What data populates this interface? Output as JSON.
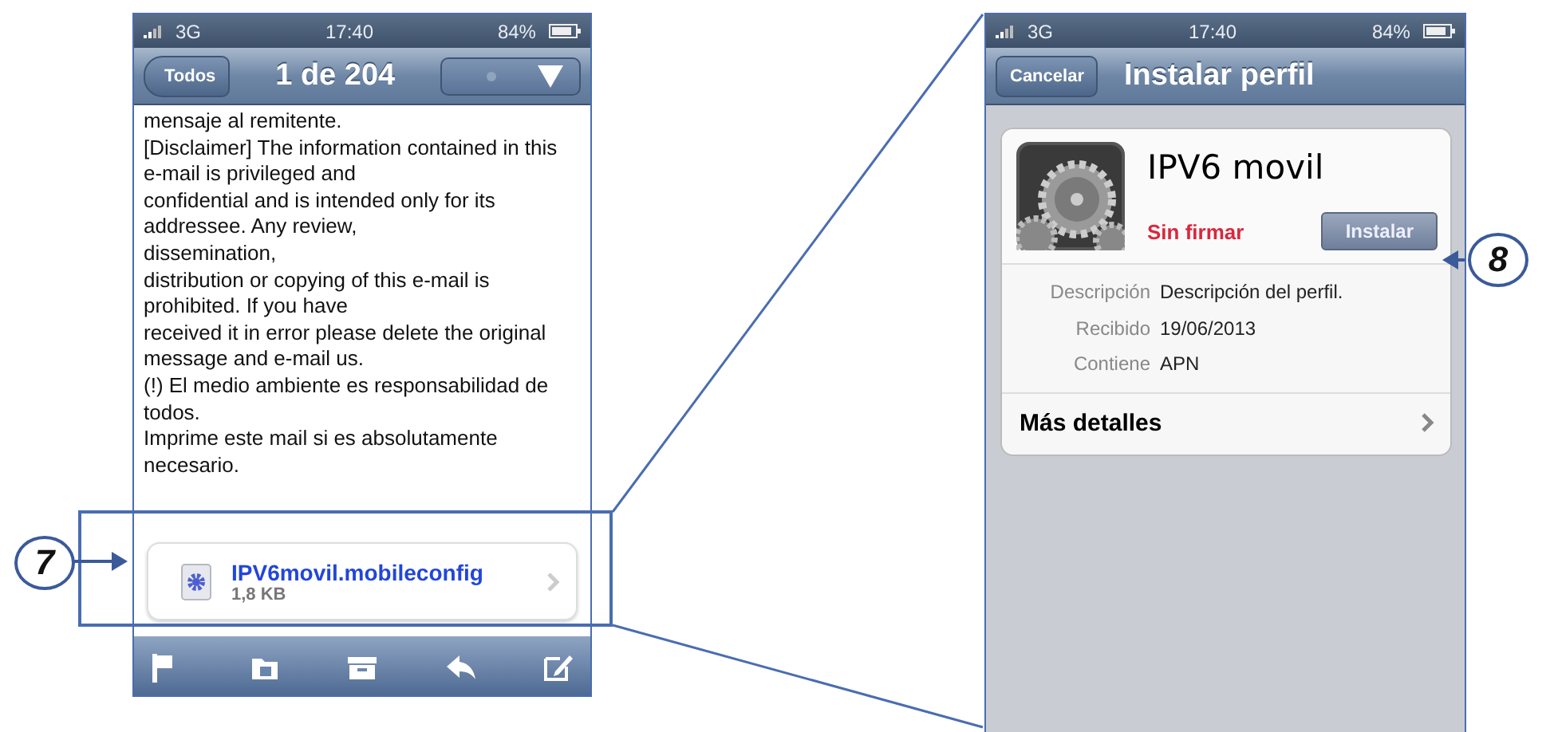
{
  "mail_screen": {
    "status_bar": {
      "network": "3G",
      "time": "17:40",
      "battery": "84%"
    },
    "nav": {
      "back_button": "Todos",
      "title": "1 de 204"
    },
    "body_lines": [
      "mensaje al remitente.",
      "[Disclaimer] The information contained in this",
      "e-mail is privileged and",
      "confidential and is intended only for its",
      "addressee. Any review,",
      "dissemination,",
      "distribution or copying of this e-mail is",
      "prohibited. If you have",
      "received it in error please delete the original",
      "message and e-mail us.",
      "(!) El medio ambiente es responsabilidad de",
      "todos.",
      "Imprime este mail si es absolutamente",
      "necesario."
    ],
    "attachment": {
      "name": "IPV6movil.mobileconfig",
      "size": "1,8 KB"
    }
  },
  "profile_screen": {
    "status_bar": {
      "network": "3G",
      "time": "17:40",
      "battery": "84%"
    },
    "nav": {
      "cancel_button": "Cancelar",
      "title": "Instalar perfil"
    },
    "profile": {
      "name": "IPV6 movil",
      "signature": "Sin firmar",
      "install_button": "Instalar",
      "details": [
        {
          "label": "Descripción",
          "value": "Descripción del perfil."
        },
        {
          "label": "Recibido",
          "value": "19/06/2013"
        },
        {
          "label": "Contiene",
          "value": "APN"
        }
      ],
      "more": "Más detalles"
    }
  },
  "callouts": [
    {
      "number": "7"
    },
    {
      "number": "8"
    }
  ]
}
